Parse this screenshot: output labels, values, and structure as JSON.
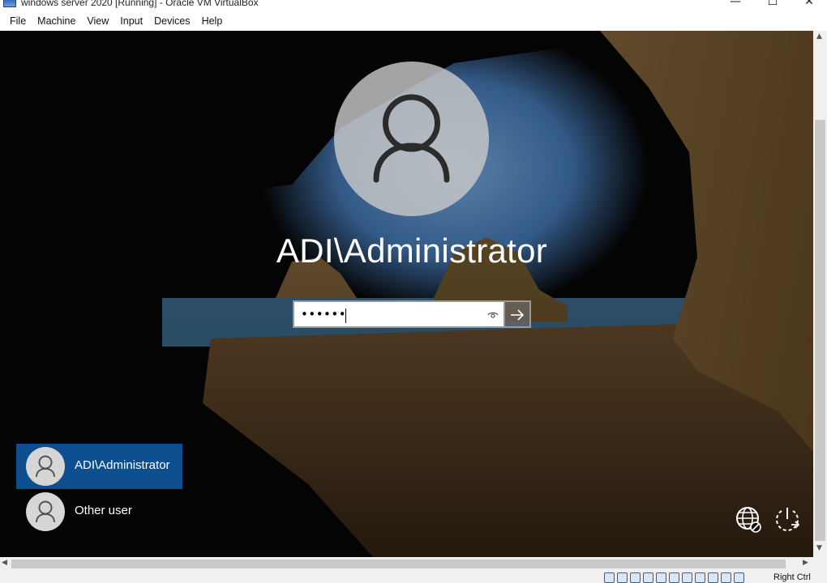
{
  "window": {
    "title": "windows server 2020 [Running] - Oracle VM VirtualBox",
    "controls": {
      "minimize": "—",
      "maximize": "☐",
      "close": "✕"
    }
  },
  "menubar": {
    "items": [
      "File",
      "Machine",
      "View",
      "Input",
      "Devices",
      "Help"
    ]
  },
  "login": {
    "user_name": "ADI\\Administrator",
    "password_value": "••••••",
    "password_input_type": "password"
  },
  "user_list": [
    {
      "label": "ADI\\Administrator",
      "selected": true
    },
    {
      "label": "Other user",
      "selected": false
    }
  ],
  "corner_icons": [
    "network-icon",
    "power-icon"
  ],
  "statusbar": {
    "host_key": "Right Ctrl",
    "icon_names": [
      "hard-disk-icon",
      "optical-drive-icon",
      "audio-icon",
      "network-icon",
      "usb-icon",
      "shared-folders-icon",
      "display-icon",
      "video-capture-icon",
      "cpu-icon",
      "mouse-integration-icon",
      "keyboard-icon"
    ]
  },
  "colors": {
    "selected_user_bg": "#0d4f8e",
    "avatar_bg": "#c8c8c8",
    "text_on_dark": "#ffffff"
  }
}
